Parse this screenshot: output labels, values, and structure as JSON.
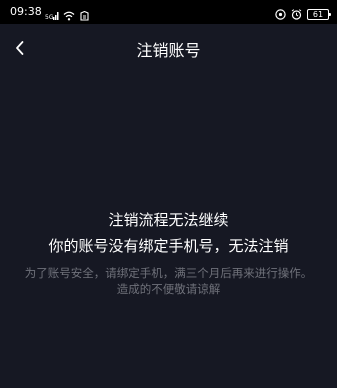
{
  "status_bar": {
    "time": "09:38",
    "battery": "61"
  },
  "nav": {
    "title": "注销账号"
  },
  "message": {
    "line1": "注销流程无法继续",
    "line2": "你的账号没有绑定手机号，无法注销",
    "description": "为了账号安全，请绑定手机，满三个月后再来进行操作。造成的不便敬请谅解"
  },
  "colors": {
    "background": "#161823",
    "status_bar": "#000000",
    "primary_text": "#ffffff",
    "secondary_text": "#6f717a"
  },
  "icons": {
    "status_left": [
      "signal-icon",
      "wifi-icon",
      "app-notification-icon"
    ],
    "status_right": [
      "headset-icon",
      "alarm-icon",
      "battery-icon"
    ],
    "nav": [
      "back-arrow-icon"
    ]
  }
}
